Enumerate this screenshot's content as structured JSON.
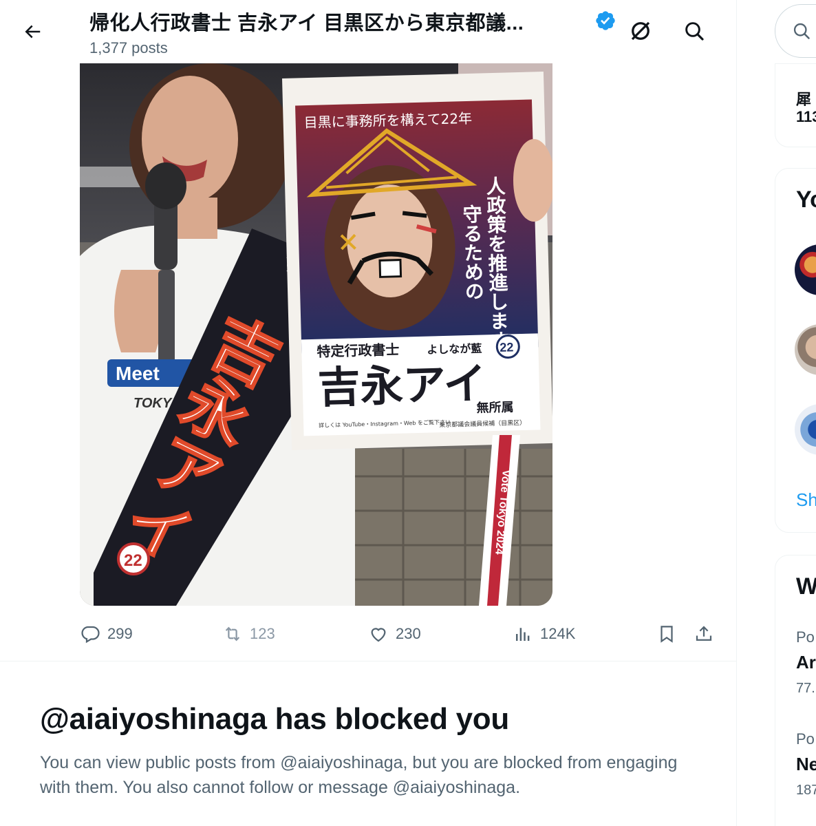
{
  "header": {
    "title": "帰化人行政書士 吉永アイ 目黒区から東京都議...",
    "post_count": "1,377 posts",
    "icons": [
      "back-arrow-icon",
      "verified-badge-icon",
      "grok-icon",
      "search-icon"
    ]
  },
  "photo": {
    "sash_text": "吉永アイ",
    "sash_badge": "22",
    "shirt_text": "TOKYO",
    "shirt_text2": "Meet",
    "sign_text_left": "無",
    "poster": {
      "top_banner": "目黒に事務所を構えて22年",
      "vertical_text": "人政策を推進します",
      "vertical_text2": "守るための",
      "job_title": "特定行政書士",
      "reading": "よしなが藍",
      "name": "吉永アイ",
      "affiliation": "無所属",
      "candidacy": "東京都議会議員候補（目黒区）",
      "small_line": "詳しくは YouTube・Instagram・Web をご覧下さい",
      "badge": "22"
    },
    "ribbon_text": "Vote Tokyo 2024"
  },
  "actions": {
    "replies": "299",
    "reposts": "123",
    "likes": "230",
    "views": "124K"
  },
  "blocked": {
    "title": "@aiaiyoshinaga has blocked you",
    "message": "You can view public posts from @aiaiyoshinaga, but you are blocked from engaging with them. You also cannot follow or message @aiaiyoshinaga."
  },
  "sidebar": {
    "profile_card": {
      "line1": "犀",
      "line2": "113"
    },
    "follow_card": {
      "title": "Yo",
      "show_more": "Sh"
    },
    "trends_card": {
      "title": "W",
      "items": [
        {
          "category": "Po",
          "name": "Ar",
          "count": "77."
        },
        {
          "category": "Po",
          "name": "Ne",
          "count": "187"
        }
      ]
    }
  },
  "colors": {
    "accent": "#1d9bf0",
    "text_primary": "#0f1419",
    "text_secondary": "#536471",
    "border": "#eff3f4",
    "sash_dark": "#1b1b24",
    "poster_red": "#8c2a35",
    "poster_blue": "#1f2f63"
  }
}
